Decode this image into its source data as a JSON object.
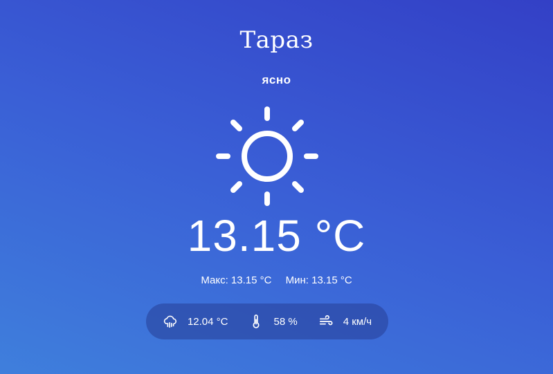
{
  "location": {
    "city": "Тараз"
  },
  "weather": {
    "description": "ясно",
    "icon": "sun-icon",
    "temperature": "13.15 °C"
  },
  "range": {
    "max_label": "Макс:",
    "max_value": "13.15 °C",
    "min_label": "Мин:",
    "min_value": "13.15 °C"
  },
  "details": {
    "feels_like": {
      "icon": "rain-cloud-icon",
      "value": "12.04 °C"
    },
    "humidity": {
      "icon": "thermometer-icon",
      "value": "58 %"
    },
    "wind": {
      "icon": "wind-icon",
      "value": "4 км/ч"
    }
  },
  "colors": {
    "background_top": "#3340c6",
    "background_bottom": "#3f7fdc",
    "text": "#ffffff"
  }
}
